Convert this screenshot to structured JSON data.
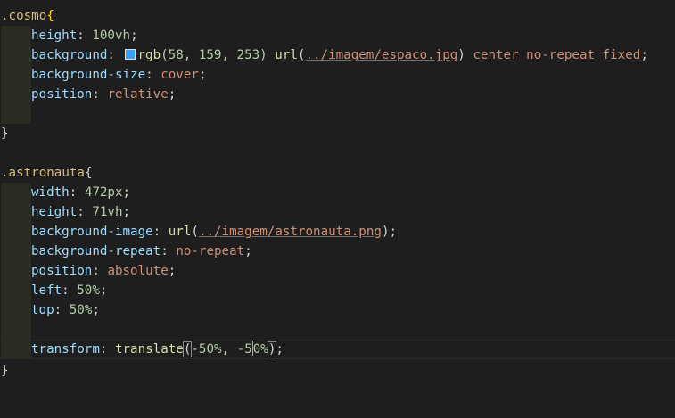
{
  "editor": {
    "lines": [
      {
        "sel": ".cosmo",
        "brace": "{"
      },
      {
        "prop": "height",
        "colon": ":",
        "value": "100vh",
        "semi": ";"
      },
      {
        "prop": "background",
        "colon": ":",
        "fn": "rgb",
        "args": "(58, 159, 253)",
        "url_fn": "url",
        "url_open": "(",
        "url_path": "../imagem/espaco.jpg",
        "url_close": ")",
        "rest": "center no-repeat fixed",
        "semi": ";",
        "swatch_color": "#3a9ffd"
      },
      {
        "prop": "background-size",
        "colon": ":",
        "value": "cover",
        "semi": ";"
      },
      {
        "prop": "position",
        "colon": ":",
        "value": "relative",
        "semi": ";"
      },
      {},
      {
        "brace": "}"
      },
      {},
      {
        "sel": ".astronauta",
        "brace": "{"
      },
      {
        "prop": "width",
        "colon": ":",
        "value": "472px",
        "semi": ";"
      },
      {
        "prop": "height",
        "colon": ":",
        "value": "71vh",
        "semi": ";"
      },
      {
        "prop": "background-image",
        "colon": ":",
        "url_fn": "url",
        "url_open": "(",
        "url_path": "../imagem/astronauta.png",
        "url_close": ")",
        "semi": ";"
      },
      {
        "prop": "background-repeat",
        "colon": ":",
        "value": "no-repeat",
        "semi": ";"
      },
      {
        "prop": "position",
        "colon": ":",
        "value": "absolute",
        "semi": ";"
      },
      {
        "prop": "left",
        "colon": ":",
        "value": "50%",
        "semi": ";"
      },
      {
        "prop": "top",
        "colon": ":",
        "value": "50%",
        "semi": ";"
      },
      {},
      {
        "prop": "transform",
        "colon": ":",
        "fn": "translate",
        "open": "(",
        "arg1": "-50%",
        "comma": ", ",
        "arg2a": "-5",
        "arg2b": "0%",
        "close": ")",
        "semi": ";"
      },
      {
        "brace": "}"
      }
    ]
  }
}
